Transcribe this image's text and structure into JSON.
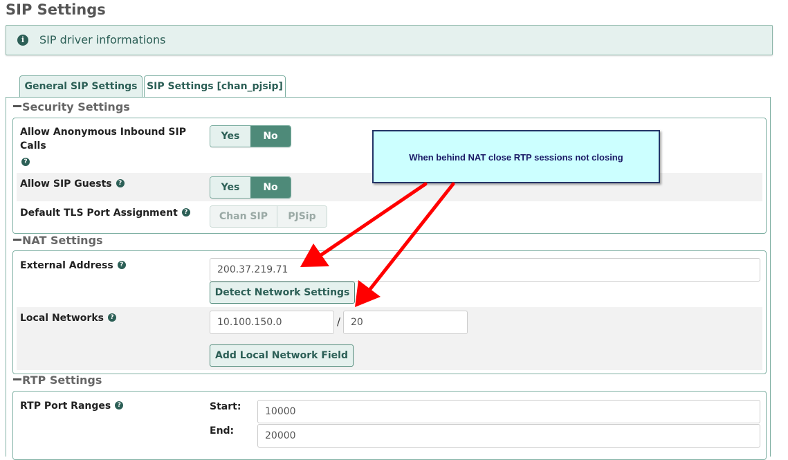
{
  "page": {
    "title": "SIP Settings"
  },
  "info": {
    "icon": "info-circle-icon",
    "text": "SIP driver informations"
  },
  "tabs": [
    {
      "label": "General SIP Settings",
      "active": true
    },
    {
      "label": "SIP Settings [chan_pjsip]",
      "active": false
    }
  ],
  "security": {
    "title": "Security Settings",
    "anonymous": {
      "label_line1": "Allow Anonymous Inbound SIP",
      "label_line2": "Calls",
      "yes": "Yes",
      "no": "No",
      "selected": "No"
    },
    "guests": {
      "label": "Allow SIP Guests",
      "yes": "Yes",
      "no": "No",
      "selected": "No"
    },
    "tls": {
      "label": "Default TLS Port Assignment",
      "option1": "Chan SIP",
      "option2": "PJSip"
    }
  },
  "nat": {
    "title": "NAT Settings",
    "external": {
      "label": "External Address",
      "value": "200.37.219.71",
      "detect_button": "Detect Network Settings"
    },
    "local": {
      "label": "Local Networks",
      "network": "10.100.150.0",
      "separator": "/",
      "cidr": "20",
      "add_button": "Add Local Network Field"
    }
  },
  "rtp": {
    "title": "RTP Settings",
    "ports": {
      "label": "RTP Port Ranges",
      "start_label": "Start:",
      "start_value": "10000",
      "end_label": "End:",
      "end_value": "20000"
    }
  },
  "annotation": {
    "text": "When behind NAT close RTP sessions not closing",
    "arrow_color": "#ff0000",
    "box_color": "#ccffff"
  }
}
